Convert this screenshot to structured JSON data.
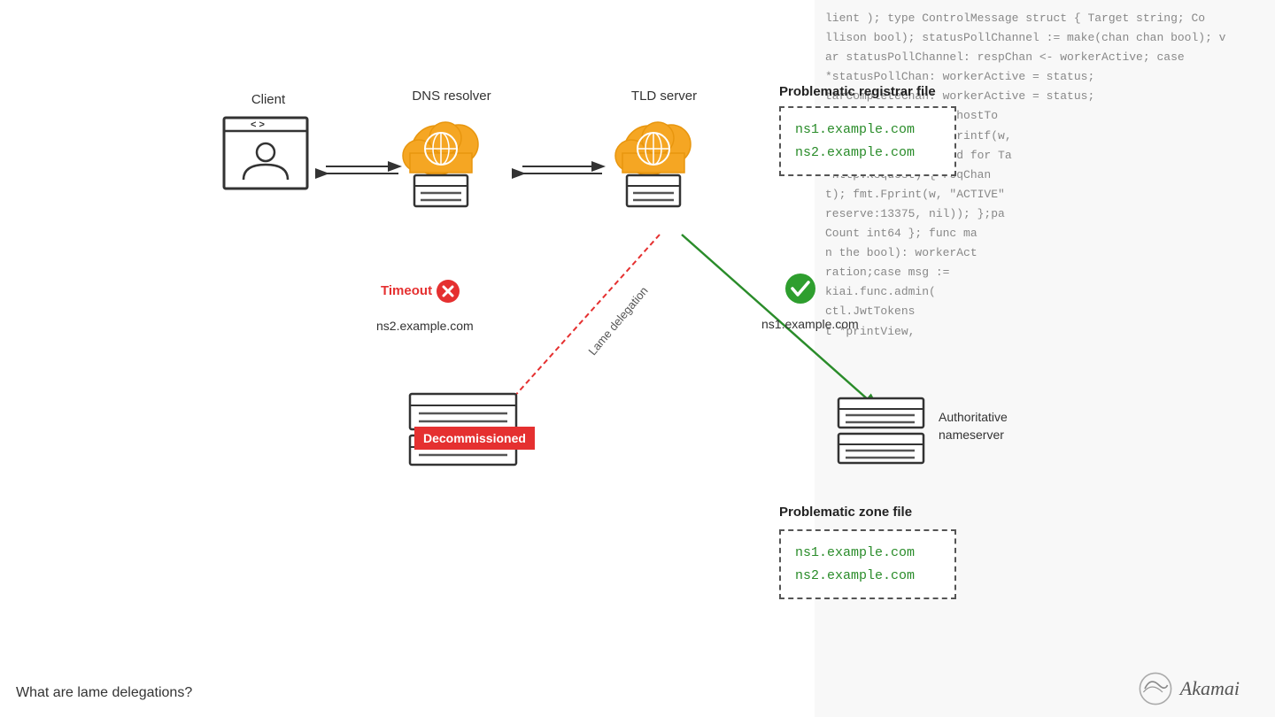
{
  "code": {
    "lines": [
      "lient ); type ControlMessage struct { Target string; Co",
      "llison bool); statusPollChannel := make(chan chan bool); v",
      "ar statusPollChannel: respChan <- workerActive; case",
      "*statusPollChan: workerActive = status;",
      "tarCompleteChan: workerActive = status;",
      "r *http.Request) { hostTo",
      "err != nil { fmt.Fprintf(w,",
      "ntrol message issued for Ta",
      "*http.Request) { reqChan",
      "t); fmt.Fprint(w, \"ACTIVE\"",
      "reserve:13375, nil)); };pa",
      "Count int64 }; func ma",
      "n the bool): workerAct",
      "ration;case msg :=",
      "kiai.func.admin(",
      "ctl.JwtTokens",
      "t *printView,"
    ]
  },
  "nodes": {
    "client_label": "Client",
    "dns_resolver_label": "DNS resolver",
    "tld_server_label": "TLD server"
  },
  "registrar_file": {
    "title": "Problematic registrar file",
    "ns1": "ns1.example.com",
    "ns2": "ns2.example.com"
  },
  "zone_file": {
    "title": "Problematic zone file",
    "ns1": "ns1.example.com",
    "ns2": "ns2.example.com"
  },
  "ns_labels": {
    "ns2_timeout": "ns2.example.com",
    "ns1_ok": "ns1.example.com"
  },
  "badges": {
    "timeout": "Timeout",
    "decommissioned": "Decommissioned",
    "lame_delegation": "Lame delegation"
  },
  "authoritative": {
    "label1": "Authoritative",
    "label2": "nameserver"
  },
  "bottom": {
    "question": "What are lame delegations?"
  },
  "logo": {
    "text": "Akamai"
  }
}
